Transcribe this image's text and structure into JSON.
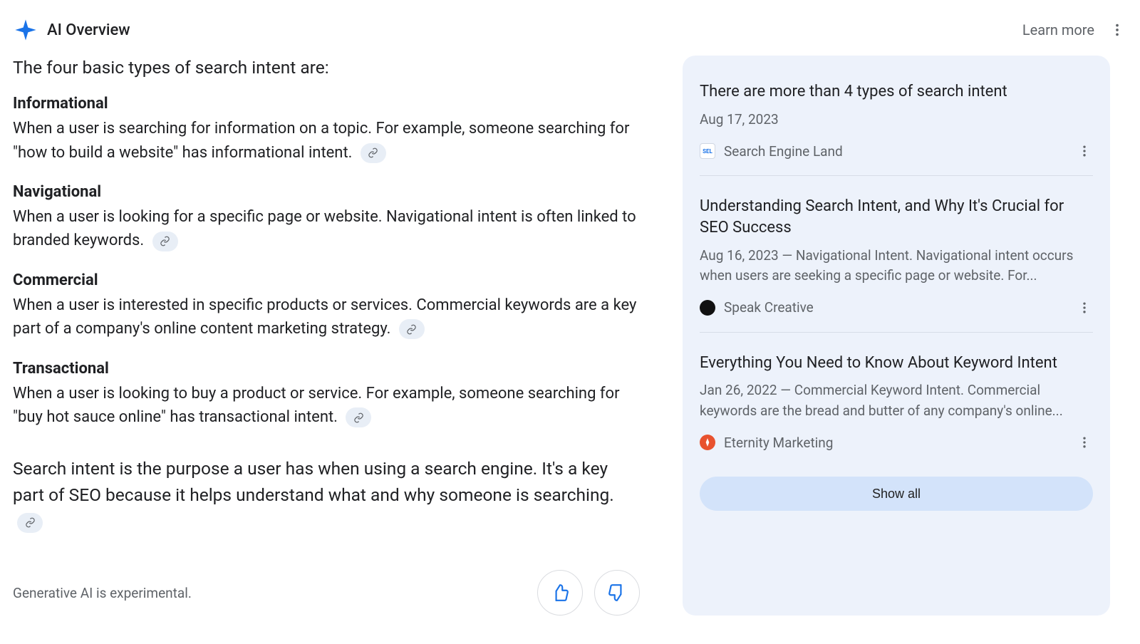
{
  "header": {
    "title": "AI Overview",
    "learn_more": "Learn more"
  },
  "overview": {
    "intro": "The four basic types of search intent are:",
    "sections": [
      {
        "heading": "Informational",
        "body": "When a user is searching for information on a topic. For example, someone searching for \"how to build a website\" has informational intent."
      },
      {
        "heading": "Navigational",
        "body": "When a user is looking for a specific page or website. Navigational intent is often linked to branded keywords."
      },
      {
        "heading": "Commercial",
        "body": "When a user is interested in specific products or services. Commercial keywords are a key part of a company's online content marketing strategy."
      },
      {
        "heading": "Transactional",
        "body": "When a user is looking to buy a product or service. For example, someone searching for \"buy hot sauce online\" has transactional intent."
      }
    ],
    "outro": "Search intent is the purpose a user has when using a search engine. It's a key part of SEO because it helps understand what and why someone is searching.",
    "disclaimer": "Generative AI is experimental."
  },
  "citations": {
    "items": [
      {
        "title": "There are more than 4 types of search intent",
        "date": "Aug 17, 2023",
        "snippet": "",
        "source": "Search Engine Land",
        "favicon": "sel"
      },
      {
        "title": "Understanding Search Intent, and Why It's Crucial for SEO Success",
        "date": "",
        "snippet": "Aug 16, 2023 — Navigational Intent. Navigational intent occurs when users are seeking a specific page or website. For...",
        "source": "Speak Creative",
        "favicon": "sc"
      },
      {
        "title": "Everything You Need to Know About Keyword Intent",
        "date": "",
        "snippet": "Jan 26, 2022 — Commercial Keyword Intent. Commercial keywords are the bread and butter of any company's online...",
        "source": "Eternity Marketing",
        "favicon": "em"
      }
    ],
    "show_all": "Show all"
  }
}
